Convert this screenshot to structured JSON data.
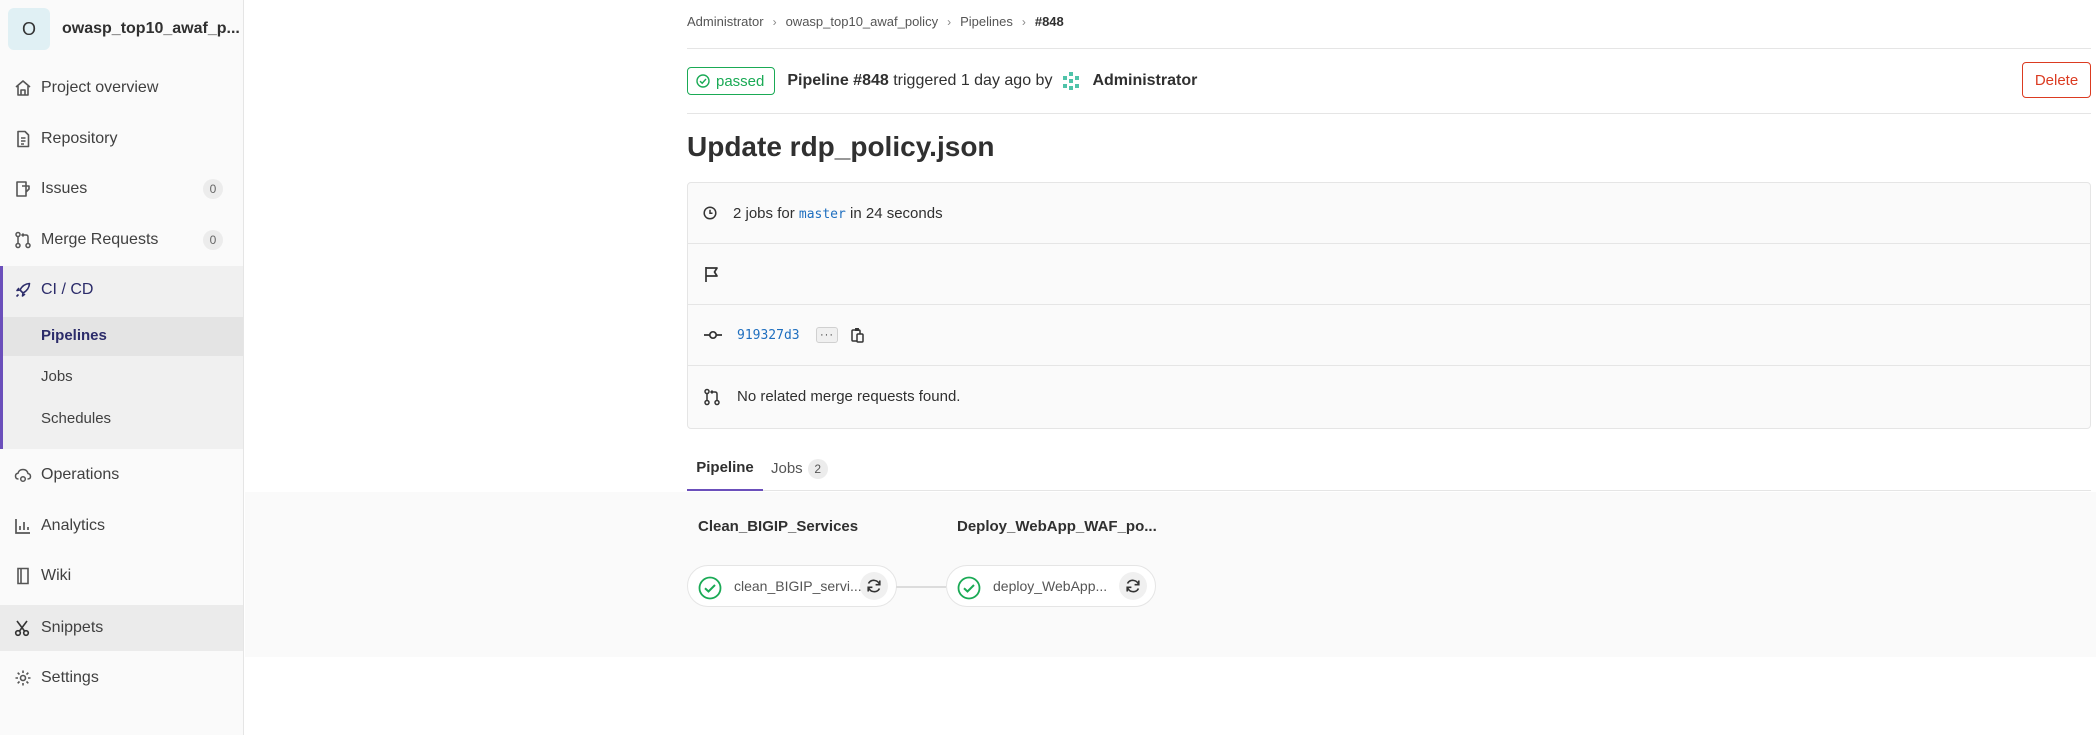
{
  "sidebar": {
    "project_initial": "O",
    "project_name": "owasp_top10_awaf_p...",
    "items": [
      {
        "label": "Project overview",
        "icon": "home-icon"
      },
      {
        "label": "Repository",
        "icon": "document-icon"
      },
      {
        "label": "Issues",
        "icon": "issues-icon",
        "count": "0"
      },
      {
        "label": "Merge Requests",
        "icon": "merge-request-icon",
        "count": "0"
      },
      {
        "label": "CI / CD",
        "icon": "rocket-icon"
      },
      {
        "label": "Operations",
        "icon": "cloud-gear-icon"
      },
      {
        "label": "Analytics",
        "icon": "chart-icon"
      },
      {
        "label": "Wiki",
        "icon": "book-icon"
      },
      {
        "label": "Snippets",
        "icon": "scissors-icon"
      },
      {
        "label": "Settings",
        "icon": "gear-icon"
      }
    ],
    "cicd_sub": [
      "Pipelines",
      "Jobs",
      "Schedules"
    ]
  },
  "breadcrumbs": [
    "Administrator",
    "owasp_top10_awaf_policy",
    "Pipelines",
    "#848"
  ],
  "header": {
    "status": "passed",
    "pipeline_label": "Pipeline #848",
    "triggered_text": "triggered 1 day ago by",
    "user": "Administrator",
    "delete_label": "Delete"
  },
  "title": "Update rdp_policy.json",
  "info": {
    "jobs_prefix": "2 jobs for",
    "branch": "master",
    "duration": "in 24 seconds",
    "commit_sha": "919327d3",
    "ellipsis": "···",
    "mr_text": "No related merge requests found."
  },
  "tabs": {
    "pipeline": "Pipeline",
    "jobs": "Jobs",
    "jobs_count": "2"
  },
  "stages": [
    {
      "title": "Clean_BIGIP_Services",
      "job": "clean_BIGIP_servi...",
      "status": "success"
    },
    {
      "title": "Deploy_WebApp_WAF_po...",
      "job": "deploy_WebApp...",
      "status": "success"
    }
  ],
  "colors": {
    "success": "#1aaa55",
    "danger": "#db3b21",
    "accent": "#6b4fbb",
    "link": "#1f6fbf"
  }
}
